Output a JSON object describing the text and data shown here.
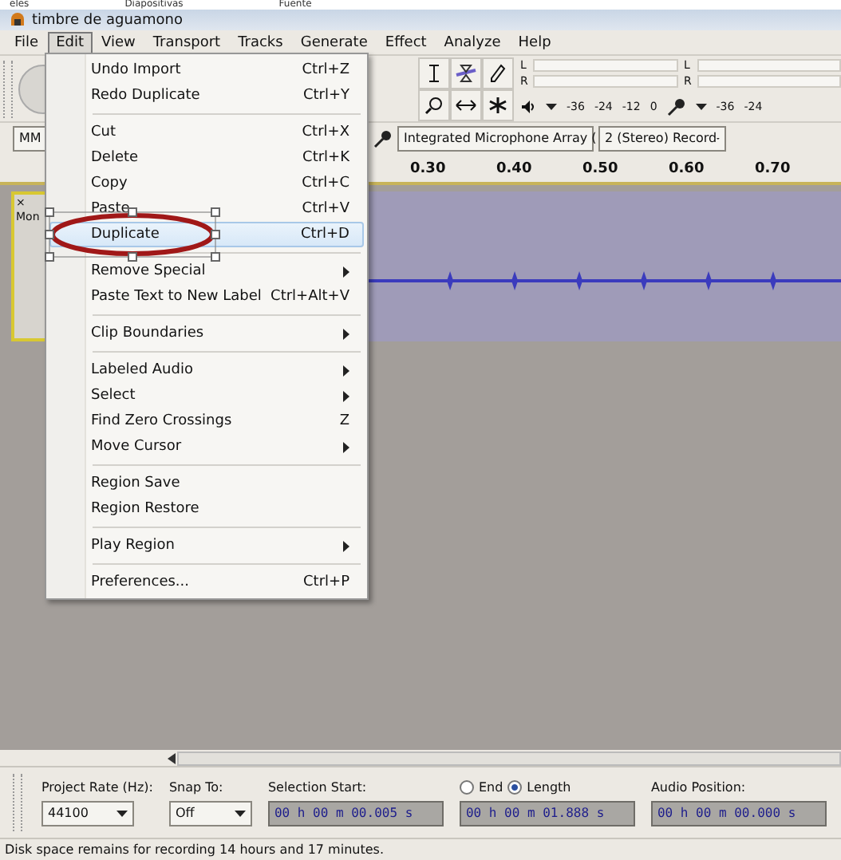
{
  "background_strip": [
    "eles",
    "Diapositivas",
    "Fuente"
  ],
  "window": {
    "title": "timbre de aguamono"
  },
  "menubar": [
    {
      "label": "File",
      "selected": false
    },
    {
      "label": "Edit",
      "selected": true
    },
    {
      "label": "View",
      "selected": false
    },
    {
      "label": "Transport",
      "selected": false
    },
    {
      "label": "Tracks",
      "selected": false
    },
    {
      "label": "Generate",
      "selected": false
    },
    {
      "label": "Effect",
      "selected": false
    },
    {
      "label": "Analyze",
      "selected": false
    },
    {
      "label": "Help",
      "selected": false
    }
  ],
  "meters": {
    "playback_channels": [
      "L",
      "R"
    ],
    "record_channels": [
      "L",
      "R"
    ],
    "playback_scale": [
      "-36",
      "-24",
      "-12",
      "0"
    ],
    "record_scale": [
      "-36",
      "-24"
    ]
  },
  "device_toolbar": {
    "host": "MM",
    "input_device": "Integrated Microphone Array (",
    "channels": "2 (Stereo) Record"
  },
  "ruler": [
    "0.30",
    "0.40",
    "0.50",
    "0.60",
    "0.70"
  ],
  "track": {
    "close": "×",
    "name": "Mon"
  },
  "edit_menu": [
    {
      "kind": "item",
      "label": "Undo Import",
      "shortcut": "Ctrl+Z",
      "submenu": false,
      "selected": false
    },
    {
      "kind": "item",
      "label": "Redo Duplicate",
      "shortcut": "Ctrl+Y",
      "submenu": false,
      "selected": false
    },
    {
      "kind": "separator"
    },
    {
      "kind": "item",
      "label": "Cut",
      "shortcut": "Ctrl+X",
      "submenu": false,
      "selected": false
    },
    {
      "kind": "item",
      "label": "Delete",
      "shortcut": "Ctrl+K",
      "submenu": false,
      "selected": false
    },
    {
      "kind": "item",
      "label": "Copy",
      "shortcut": "Ctrl+C",
      "submenu": false,
      "selected": false
    },
    {
      "kind": "item",
      "label": "Paste",
      "shortcut": "Ctrl+V",
      "submenu": false,
      "selected": false
    },
    {
      "kind": "item",
      "label": "Duplicate",
      "shortcut": "Ctrl+D",
      "submenu": false,
      "selected": true
    },
    {
      "kind": "separator"
    },
    {
      "kind": "item",
      "label": "Remove Special",
      "submenu": true,
      "selected": false
    },
    {
      "kind": "item",
      "label": "Paste Text to New Label",
      "shortcut": "Ctrl+Alt+V",
      "submenu": false,
      "selected": false
    },
    {
      "kind": "separator"
    },
    {
      "kind": "item",
      "label": "Clip Boundaries",
      "submenu": true,
      "selected": false
    },
    {
      "kind": "separator"
    },
    {
      "kind": "item",
      "label": "Labeled Audio",
      "submenu": true,
      "selected": false
    },
    {
      "kind": "item",
      "label": "Select",
      "submenu": true,
      "selected": false
    },
    {
      "kind": "item",
      "label": "Find Zero Crossings",
      "shortcut": "Z",
      "submenu": false,
      "selected": false
    },
    {
      "kind": "item",
      "label": "Move Cursor",
      "submenu": true,
      "selected": false
    },
    {
      "kind": "separator"
    },
    {
      "kind": "item",
      "label": "Region Save",
      "submenu": false,
      "selected": false
    },
    {
      "kind": "item",
      "label": "Region Restore",
      "submenu": false,
      "selected": false
    },
    {
      "kind": "separator"
    },
    {
      "kind": "item",
      "label": "Play Region",
      "submenu": true,
      "selected": false
    },
    {
      "kind": "separator"
    },
    {
      "kind": "item",
      "label": "Preferences...",
      "shortcut": "Ctrl+P",
      "submenu": false,
      "selected": false
    }
  ],
  "selection_toolbar": {
    "project_rate_label": "Project Rate (Hz):",
    "project_rate": "44100",
    "snap_label": "Snap To:",
    "snap": "Off",
    "start_label": "Selection Start:",
    "start": "00 h 00 m 00.005 s",
    "modes": [
      {
        "label": "End",
        "selected": false
      },
      {
        "label": "Length",
        "selected": true
      }
    ],
    "length": "00 h 00 m 01.888 s",
    "position_label": "Audio Position:",
    "position": "00 h 00 m 00.000 s"
  },
  "status_bar": "Disk space remains for recording 14 hours and 17 minutes."
}
